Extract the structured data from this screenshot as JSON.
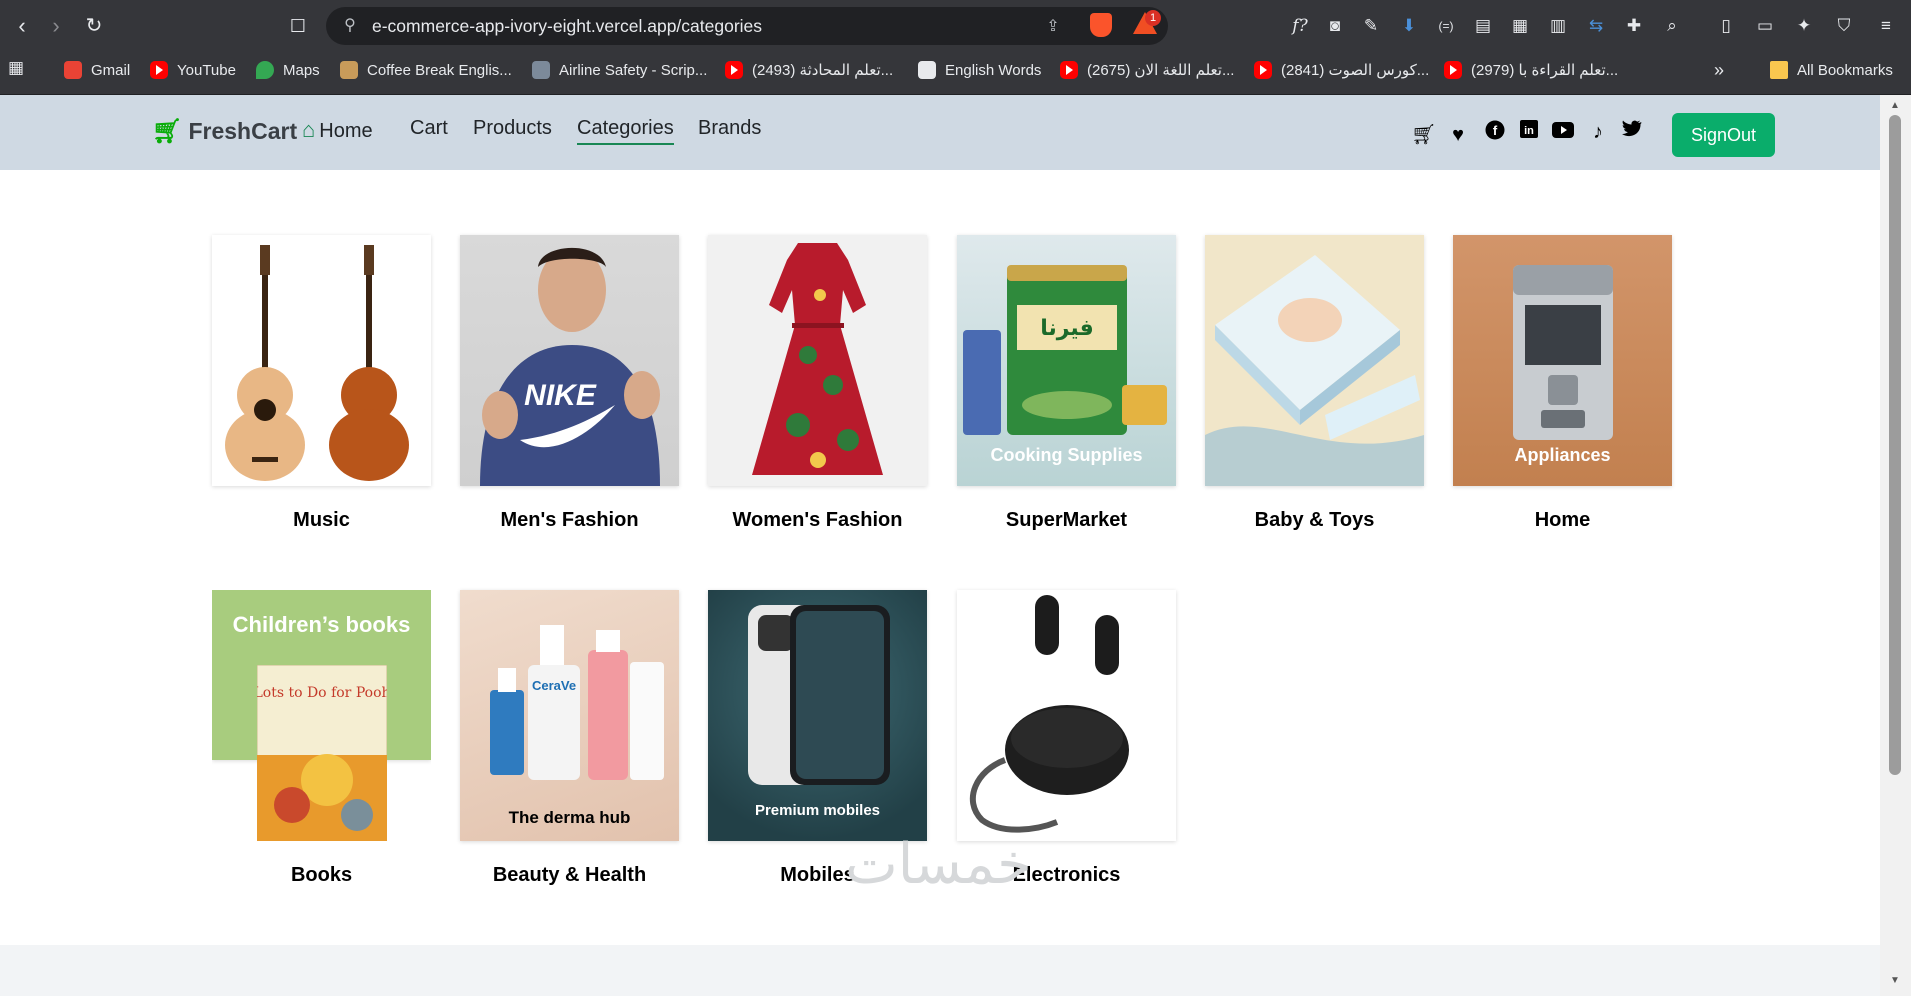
{
  "browser": {
    "url": "e-commerce-app-ivory-eight.vercel.app/categories",
    "brave_badge": "1",
    "bookmarks": [
      {
        "label": "Gmail"
      },
      {
        "label": "YouTube"
      },
      {
        "label": "Maps"
      },
      {
        "label": "Coffee Break Englis..."
      },
      {
        "label": "Airline Safety - Scrip..."
      },
      {
        "label": "(2493) تعلم المحادثة..."
      },
      {
        "label": "English Words"
      },
      {
        "label": "(2675) تعلم اللغة الان..."
      },
      {
        "label": "(2841) كورس الصوت..."
      },
      {
        "label": "(2979) تعلم القراءة با..."
      }
    ],
    "all_bookmarks": "All Bookmarks",
    "more": "»"
  },
  "nav": {
    "logo": "FreshCart",
    "links": [
      "Home",
      "Cart",
      "Products",
      "Categories",
      "Brands"
    ],
    "active": "Categories",
    "signout": "SignOut"
  },
  "categories": [
    {
      "name": "Music"
    },
    {
      "name": "Men's Fashion"
    },
    {
      "name": "Women's Fashion"
    },
    {
      "name": "SuperMarket",
      "overlay": "Cooking Supplies"
    },
    {
      "name": "Baby & Toys"
    },
    {
      "name": "Home",
      "overlay": "Appliances"
    },
    {
      "name": "Books",
      "overlay": "Children’s books"
    },
    {
      "name": "Beauty & Health",
      "overlay": "The derma hub"
    },
    {
      "name": "Mobiles",
      "overlay": "Premium mobiles"
    },
    {
      "name": "Electronics"
    }
  ],
  "images": {
    "nike_text": "NIKE",
    "supermarket_can": "فيرنا",
    "book_title": "Lots to Do for Pooh",
    "cerave": "CeraVe"
  },
  "footer": {
    "watermark": "خمسات"
  }
}
